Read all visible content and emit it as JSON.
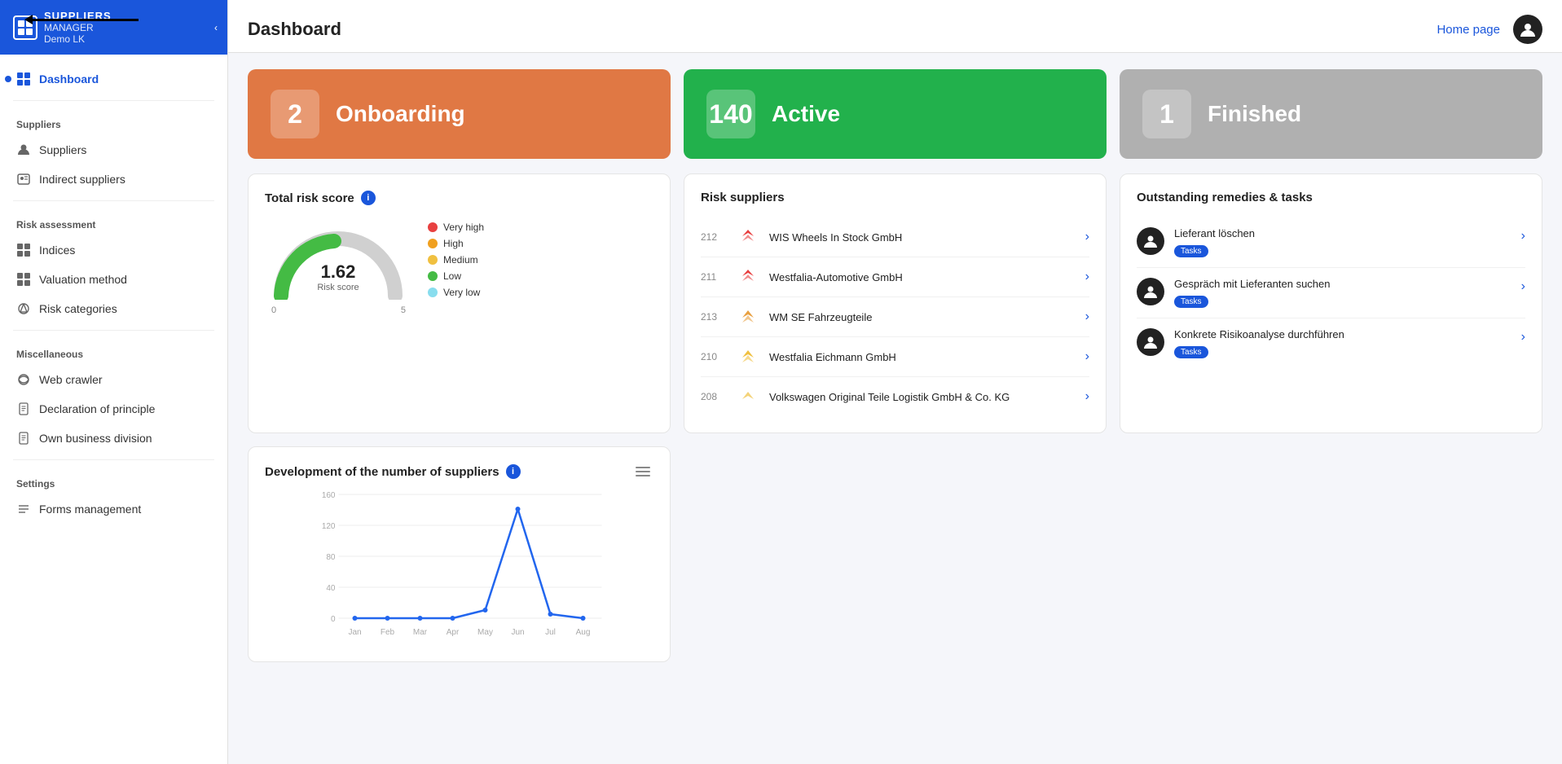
{
  "sidebar": {
    "brand": "SUPPLIERS",
    "user": "MANAGER",
    "demo": "Demo LK",
    "collapse_label": "‹",
    "nav_items": [
      {
        "id": "dashboard",
        "label": "Dashboard",
        "icon": "grid",
        "active": true,
        "section": null
      }
    ],
    "sections": [
      {
        "label": "Suppliers",
        "items": [
          {
            "id": "suppliers",
            "label": "Suppliers",
            "icon": "person"
          },
          {
            "id": "indirect-suppliers",
            "label": "Indirect suppliers",
            "icon": "person-indirect"
          }
        ]
      },
      {
        "label": "Risk assessment",
        "items": [
          {
            "id": "indices",
            "label": "Indices",
            "icon": "grid-small"
          },
          {
            "id": "valuation-method",
            "label": "Valuation method",
            "icon": "grid-small"
          },
          {
            "id": "risk-categories",
            "label": "Risk categories",
            "icon": "share"
          }
        ]
      },
      {
        "label": "Miscellaneous",
        "items": [
          {
            "id": "web-crawler",
            "label": "Web crawler",
            "icon": "refresh"
          },
          {
            "id": "declaration-of-principle",
            "label": "Declaration of principle",
            "icon": "doc"
          },
          {
            "id": "own-business-division",
            "label": "Own business division",
            "icon": "doc"
          }
        ]
      },
      {
        "label": "Settings",
        "items": [
          {
            "id": "forms-management",
            "label": "Forms management",
            "icon": "list"
          }
        ]
      }
    ]
  },
  "topbar": {
    "title": "Dashboard",
    "home_link": "Home page"
  },
  "status_cards": [
    {
      "id": "onboarding",
      "number": "2",
      "label": "Onboarding",
      "color": "#e07844"
    },
    {
      "id": "active",
      "number": "140",
      "label": "Active",
      "color": "#22b14c"
    },
    {
      "id": "finished",
      "number": "1",
      "label": "Finished",
      "color": "#b0b0b0"
    }
  ],
  "total_risk_score": {
    "title": "Total risk score",
    "value": "1.62",
    "subtitle": "Risk score",
    "scale_min": "0",
    "scale_max": "5",
    "legend": [
      {
        "label": "Very high",
        "color": "#e84040"
      },
      {
        "label": "High",
        "color": "#f0a020"
      },
      {
        "label": "Medium",
        "color": "#f0c040"
      },
      {
        "label": "Low",
        "color": "#44bb44"
      },
      {
        "label": "Very low",
        "color": "#88ddee"
      }
    ]
  },
  "risk_suppliers": {
    "title": "Risk suppliers",
    "items": [
      {
        "id": "212",
        "name": "WIS Wheels In Stock GmbH",
        "level": "high"
      },
      {
        "id": "211",
        "name": "Westfalia-Automotive GmbH",
        "level": "high"
      },
      {
        "id": "213",
        "name": "WM SE Fahrzeugteile",
        "level": "medium"
      },
      {
        "id": "210",
        "name": "Westfalia Eichmann GmbH",
        "level": "medium-low"
      },
      {
        "id": "208",
        "name": "Volkswagen Original Teile Logistik GmbH & Co. KG",
        "level": "low"
      }
    ]
  },
  "outstanding_tasks": {
    "title": "Outstanding remedies & tasks",
    "items": [
      {
        "id": 1,
        "title": "Lieferant löschen",
        "badge": "Tasks"
      },
      {
        "id": 2,
        "title": "Gespräch mit Lieferanten suchen",
        "badge": "Tasks"
      },
      {
        "id": 3,
        "title": "Konkrete Risikoanalyse durchführen",
        "badge": "Tasks"
      }
    ]
  },
  "suppliers_chart": {
    "title": "Development of the number of suppliers",
    "y_labels": [
      "160",
      "120",
      "80",
      "40",
      "0"
    ],
    "x_labels": [
      "Jan",
      "Feb",
      "Mar",
      "Apr",
      "May",
      "Jun",
      "Jul",
      "Aug"
    ],
    "data_points": [
      0,
      0,
      0,
      0,
      20,
      140,
      5,
      0
    ]
  }
}
